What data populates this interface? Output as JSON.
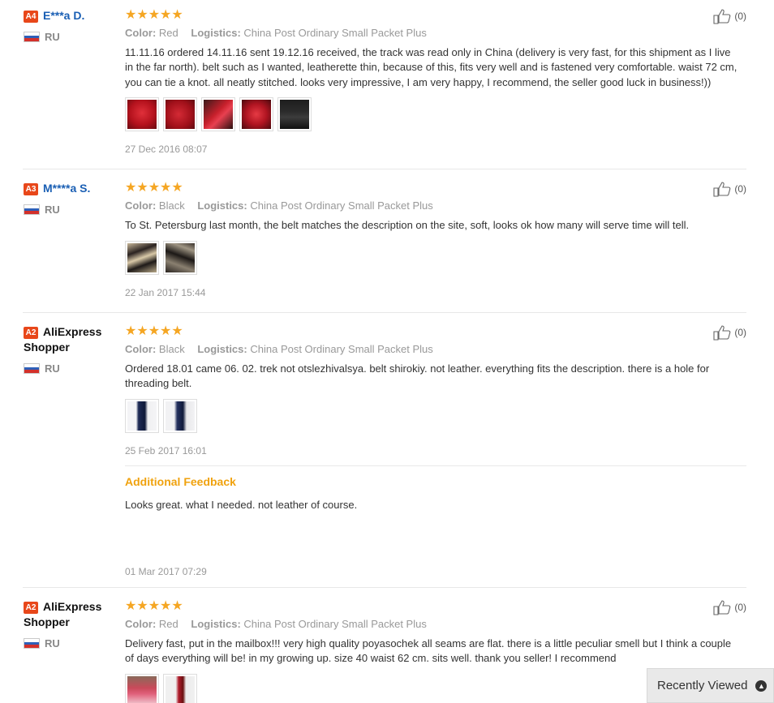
{
  "labels": {
    "color": "Color:",
    "logistics": "Logistics:",
    "additional_feedback": "Additional Feedback"
  },
  "reviews": [
    {
      "level": "A4",
      "name": "E***a D.",
      "country": "RU",
      "stars": "★★★★★",
      "color": "Red",
      "logistics": "China Post Ordinary Small Packet Plus",
      "text": "11.11.16 ordered 14.11.16 sent 19.12.16 received, the track was read only in China (delivery is very fast, for this shipment as I live in the far north). belt such as I wanted, leatherette thin, because of this, fits very well and is fastened very comfortable. waist 72 cm, you can tie a knot. all neatly stitched. looks very impressive, I am very happy, I recommend, the seller good luck in business!))",
      "date": "27 Dec 2016 08:07",
      "likes": "(0)"
    },
    {
      "level": "A3",
      "name": "M****a S.",
      "country": "RU",
      "stars": "★★★★★",
      "color": "Black",
      "logistics": "China Post Ordinary Small Packet Plus",
      "text": "To St. Petersburg last month, the belt matches the description on the site, soft, looks ok how many will serve time will tell.",
      "date": "22 Jan 2017 15:44",
      "likes": "(0)"
    },
    {
      "level": "A2",
      "name": "AliExpress Shopper",
      "country": "RU",
      "stars": "★★★★★",
      "color": "Black",
      "logistics": "China Post Ordinary Small Packet Plus",
      "text": "Ordered 18.01 came 06. 02. trek not otslezhivalsya. belt shirokiy. not leather. everything fits the description. there is a hole for threading belt.",
      "date": "25 Feb 2017 16:01",
      "likes": "(0)",
      "additional_text": "Looks great. what I needed. not leather of course.",
      "additional_date": "01 Mar 2017 07:29"
    },
    {
      "level": "A2",
      "name": "AliExpress Shopper",
      "country": "RU",
      "stars": "★★★★★",
      "color": "Red",
      "logistics": "China Post Ordinary Small Packet Plus",
      "text": "Delivery fast, put in the mailbox!!! very high quality poyasochek all seams are flat. there is a little peculiar smell but I think a couple of days everything will be! in my growing up. size 40 waist 62 cm. sits well. thank you seller! I recommend",
      "likes": "(0)"
    }
  ],
  "recently_viewed": {
    "label": "Recently Viewed",
    "icon": "chevron-up-icon"
  }
}
